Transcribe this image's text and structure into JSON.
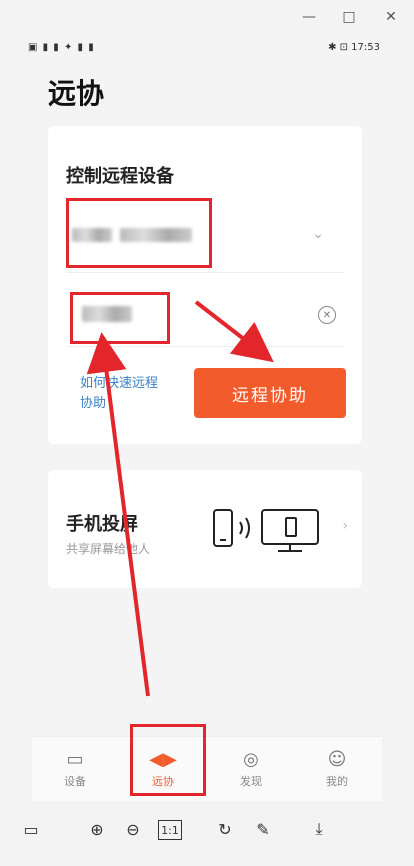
{
  "window": {
    "minimize": "—",
    "maximize": "□",
    "close": "✕"
  },
  "status": {
    "right": "✱ ⊡ 17:53"
  },
  "page": {
    "title": "远协"
  },
  "remote": {
    "title": "控制远程设备",
    "help_link": "如何快速远程协助",
    "button": "远程协助"
  },
  "cast": {
    "title": "手机投屏",
    "subtitle": "共享屏幕给他人"
  },
  "tabs": [
    {
      "label": "设备",
      "icon": "device-icon"
    },
    {
      "label": "远协",
      "icon": "remote-assist-icon",
      "active": true
    },
    {
      "label": "发现",
      "icon": "discover-icon"
    },
    {
      "label": "我的",
      "icon": "profile-icon"
    }
  ],
  "toolbar": {
    "zoom_reset_label": "1:1"
  },
  "colors": {
    "accent": "#f25c2c",
    "annotation": "#e3262b",
    "link": "#3b80c8"
  }
}
